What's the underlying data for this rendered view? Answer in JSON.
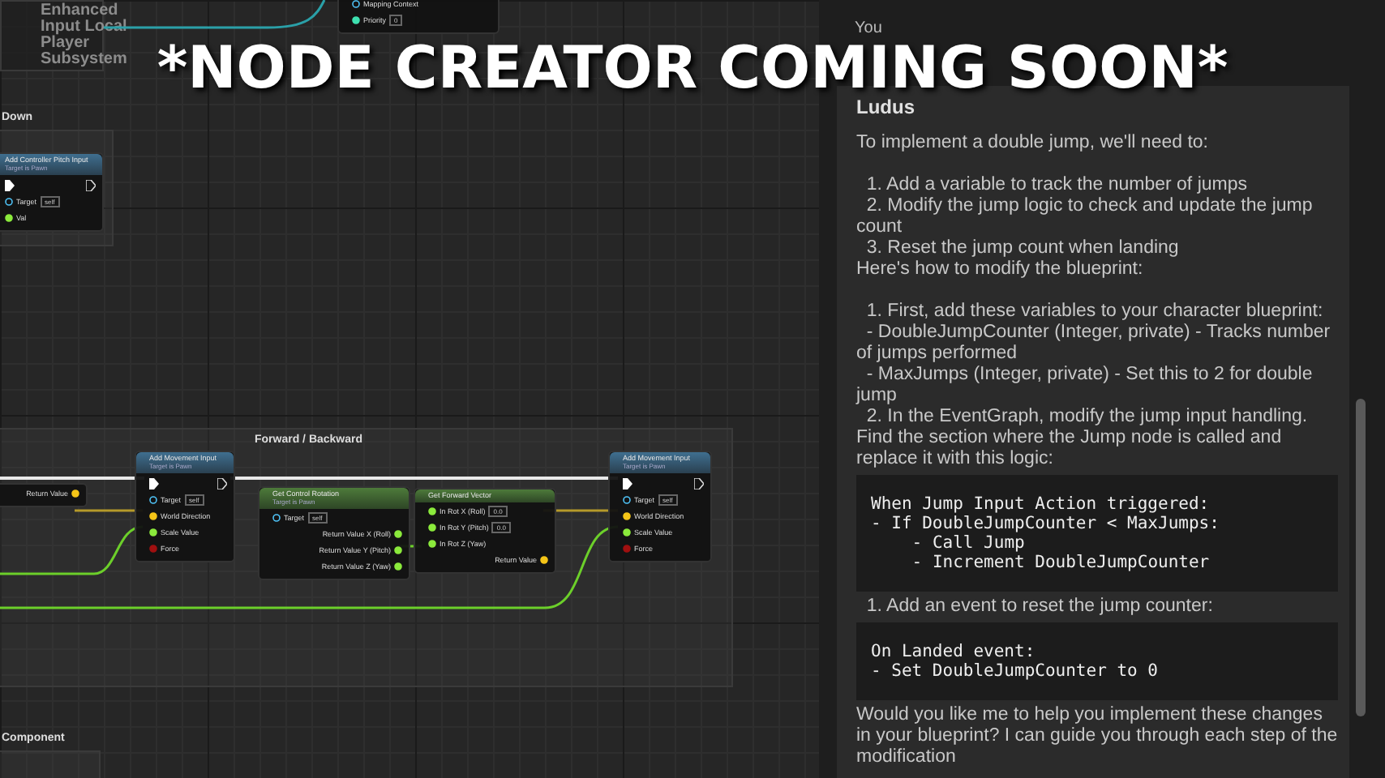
{
  "banner": "*NODE CREATOR COMING SOON*",
  "graph": {
    "comments": [
      {
        "title": "Enhanced Input Local Player Subsystem"
      },
      {
        "title": "Down"
      },
      {
        "title": "Forward / Backward"
      },
      {
        "title": "Component"
      }
    ],
    "nodes": [
      {
        "inputs": [
          {
            "label": "Mapping Context",
            "kind": "object"
          },
          {
            "label": "Priority",
            "kind": "int",
            "value": "0"
          }
        ]
      },
      {
        "kind": "call",
        "title": "Add Controller Pitch Input",
        "subtitle": "Target is Pawn",
        "exec": true,
        "inputs": [
          {
            "label": "Target",
            "kind": "object",
            "value": "self"
          },
          {
            "label": "Val",
            "kind": "float"
          }
        ]
      },
      {
        "outputs": [
          {
            "label": "Return Value",
            "kind": "vector"
          }
        ]
      },
      {
        "kind": "call",
        "title": "Add Movement Input",
        "subtitle": "Target is Pawn",
        "exec": true,
        "inputs": [
          {
            "label": "Target",
            "kind": "object",
            "value": "self"
          },
          {
            "label": "World Direction",
            "kind": "vector"
          },
          {
            "label": "Scale Value",
            "kind": "float"
          },
          {
            "label": "Force",
            "kind": "bool"
          }
        ]
      },
      {
        "kind": "pure",
        "title": "Get Control Rotation",
        "subtitle": "Target is Pawn",
        "inputs": [
          {
            "label": "Target",
            "kind": "object",
            "value": "self"
          }
        ],
        "outputs": [
          {
            "label": "Return Value X (Roll)",
            "kind": "float"
          },
          {
            "label": "Return Value Y (Pitch)",
            "kind": "float"
          },
          {
            "label": "Return Value Z (Yaw)",
            "kind": "float"
          }
        ]
      },
      {
        "kind": "pure",
        "title": "Get Forward Vector",
        "inputs": [
          {
            "label": "In Rot X (Roll)",
            "kind": "float",
            "value": "0.0"
          },
          {
            "label": "In Rot Y (Pitch)",
            "kind": "float",
            "value": "0.0"
          },
          {
            "label": "In Rot Z (Yaw)",
            "kind": "float"
          }
        ],
        "outputs": [
          {
            "label": "Return Value",
            "kind": "vector"
          }
        ]
      },
      {
        "kind": "call",
        "title": "Add Movement Input",
        "subtitle": "Target is Pawn",
        "exec": true,
        "inputs": [
          {
            "label": "Target",
            "kind": "object",
            "value": "self"
          },
          {
            "label": "World Direction",
            "kind": "vector"
          },
          {
            "label": "Scale Value",
            "kind": "float"
          },
          {
            "label": "Force",
            "kind": "bool"
          }
        ]
      }
    ]
  },
  "chat": {
    "messages": [
      {
        "author": "You",
        "kind": "user"
      },
      {
        "author": "Ludus",
        "kind": "assistant",
        "blocks": [
          {
            "kind": "text",
            "text": "To implement a double jump, we'll need to:\n\n  1. Add a variable to track the number of jumps\n  2. Modify the jump logic to check and update the jump count\n  3. Reset the jump count when landing\nHere's how to modify the blueprint:\n\n  1. First, add these variables to your character blueprint:\n  - DoubleJumpCounter (Integer, private) - Tracks number of jumps performed\n  - MaxJumps (Integer, private) - Set this to 2 for double jump\n  2. In the EventGraph, modify the jump input handling. Find the section where the Jump node is called and replace it with this logic:"
          },
          {
            "kind": "code",
            "text": "When Jump Input Action triggered:\n- If DoubleJumpCounter < MaxJumps:\n    - Call Jump\n    - Increment DoubleJumpCounter"
          },
          {
            "kind": "text",
            "text": "  1. Add an event to reset the jump counter:"
          },
          {
            "kind": "code",
            "text": "On Landed event:\n- Set DoubleJumpCounter to 0"
          },
          {
            "kind": "text",
            "text": "Would you like me to help you implement these changes in your blueprint? I can guide you through each step of the modification"
          }
        ]
      }
    ]
  }
}
